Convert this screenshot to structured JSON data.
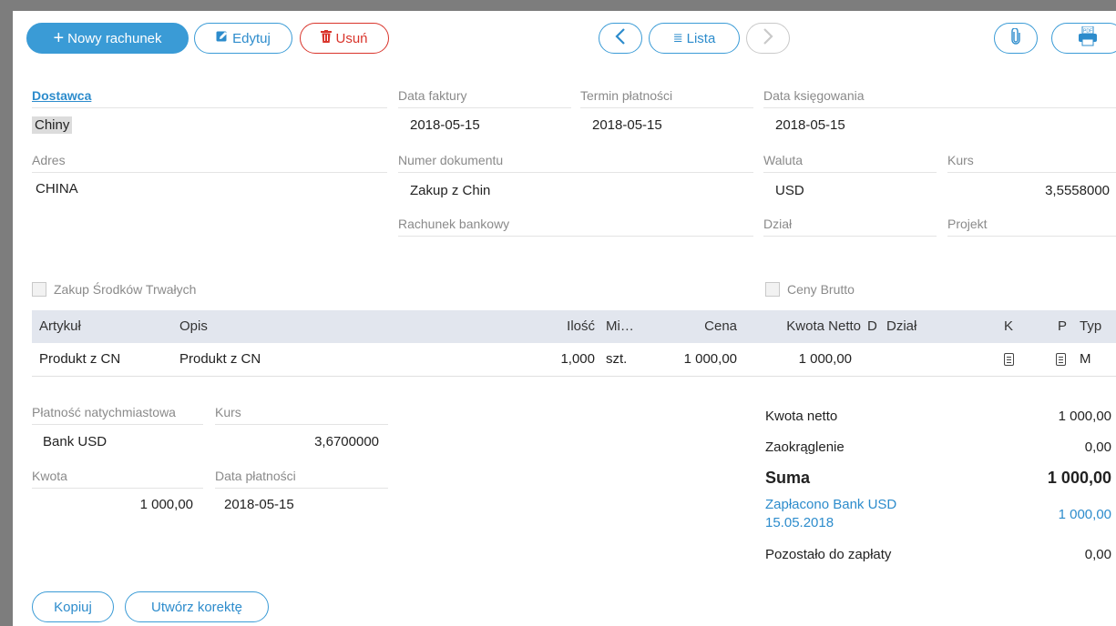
{
  "toolbar": {
    "new_label": "Nowy rachunek",
    "edit_label": "Edytuj",
    "delete_label": "Usuń",
    "list_label": "Lista"
  },
  "supplier": {
    "label": "Dostawca",
    "value": "Chiny"
  },
  "invoice_date": {
    "label": "Data faktury",
    "value": "2018-05-15"
  },
  "due_date": {
    "label": "Termin płatności",
    "value": "2018-05-15"
  },
  "posting_date": {
    "label": "Data księgowania",
    "value": "2018-05-15"
  },
  "address": {
    "label": "Adres",
    "value": "CHINA"
  },
  "document_number": {
    "label": "Numer dokumentu",
    "value": "Zakup z Chin"
  },
  "currency": {
    "label": "Waluta",
    "value": "USD"
  },
  "rate": {
    "label": "Kurs",
    "value": "3,5558000"
  },
  "bank_account": {
    "label": "Rachunek bankowy",
    "value": ""
  },
  "department": {
    "label": "Dział",
    "value": ""
  },
  "project": {
    "label": "Projekt",
    "value": ""
  },
  "fixed_assets": {
    "label": "Zakup Środków Trwałych",
    "checked": false
  },
  "gross_prices": {
    "label": "Ceny Brutto",
    "checked": false
  },
  "table": {
    "headers": {
      "item": "Artykuł",
      "desc": "Opis",
      "qty": "Ilość",
      "unit": "Mi…",
      "price": "Cena",
      "net": "Kwota Netto",
      "d": "D",
      "dept": "Dział",
      "k": "K",
      "p": "P",
      "type": "Typ"
    },
    "rows": [
      {
        "item": "Produkt z CN",
        "desc": "Produkt z CN",
        "qty": "1,000",
        "unit": "szt.",
        "price": "1 000,00",
        "net": "1 000,00",
        "d": "",
        "dept": "",
        "k_icon": "document-icon",
        "p_icon": "document-icon",
        "type": "M"
      }
    ]
  },
  "payment": {
    "immediate_label": "Płatność natychmiastowa",
    "account": "Bank USD",
    "rate_label": "Kurs",
    "rate": "3,6700000",
    "amount_label": "Kwota",
    "amount": "1 000,00",
    "date_label": "Data płatności",
    "date": "2018-05-15"
  },
  "summary": {
    "net_label": "Kwota netto",
    "net": "1 000,00",
    "rounding_label": "Zaokrąglenie",
    "rounding": "0,00",
    "total_label": "Suma",
    "total": "1 000,00",
    "paid_label_1": "Zapłacono Bank USD",
    "paid_label_2": "15.05.2018",
    "paid": "1 000,00",
    "remaining_label": "Pozostało do zapłaty",
    "remaining": "0,00"
  },
  "footer": {
    "copy_label": "Kopiuj",
    "correction_label": "Utwórz korektę"
  },
  "colors": {
    "accent": "#3a9bd6",
    "danger": "#d9342b",
    "table_header": "#e2e6ee"
  }
}
